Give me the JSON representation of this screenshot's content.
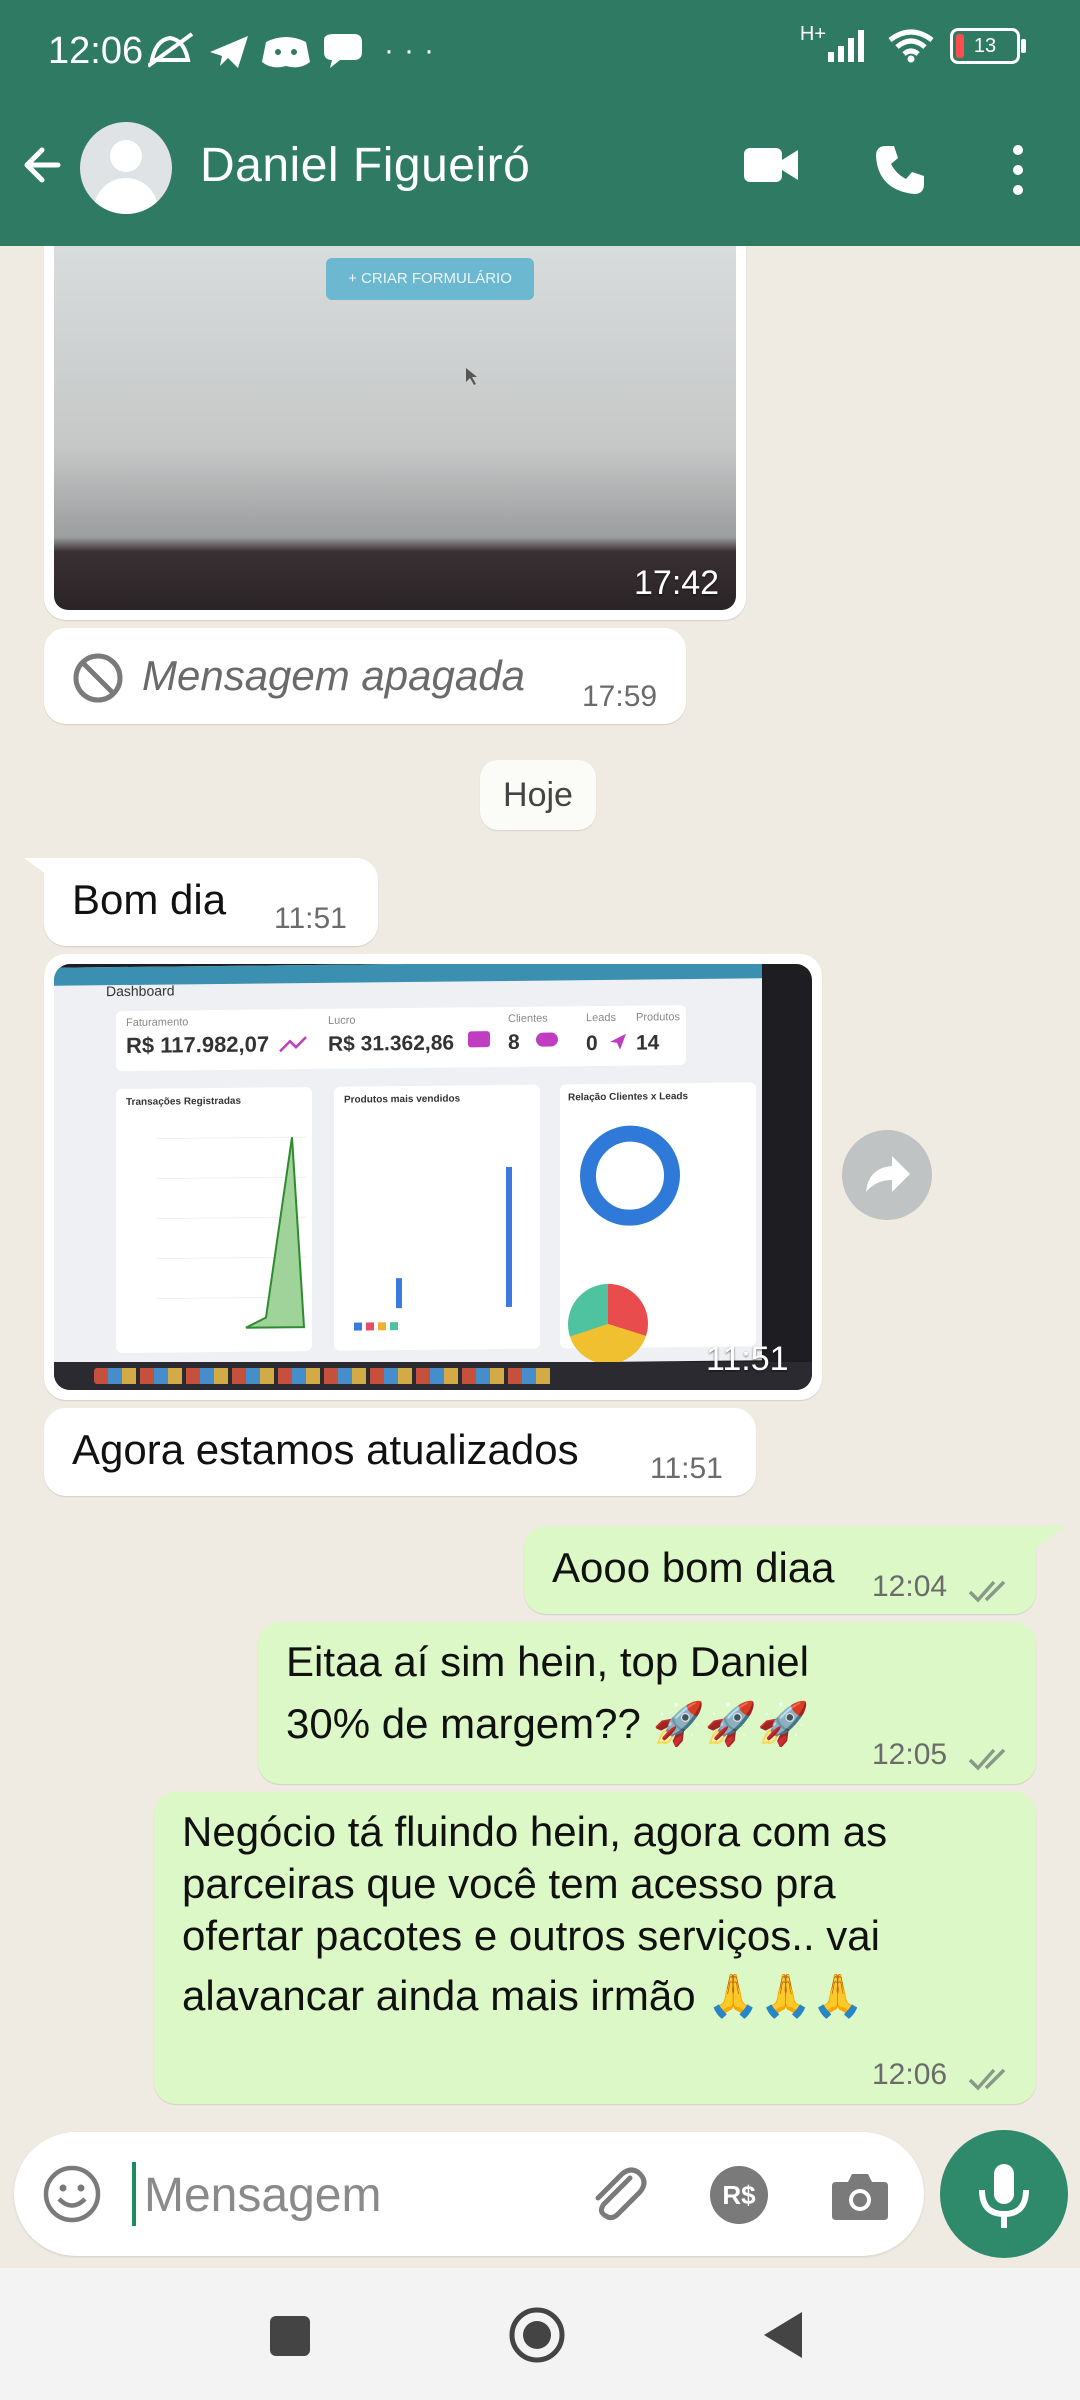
{
  "status_bar": {
    "time": "12:06",
    "more": "···",
    "network": "H+",
    "battery_level": "13"
  },
  "header": {
    "contact_name": "Daniel Figueiró",
    "back_icon": "back-arrow-icon",
    "video_icon": "video-call-icon",
    "call_icon": "phone-icon",
    "menu_icon": "more-vertical-icon",
    "bg_color": "#2f7a62"
  },
  "messages": {
    "m1_time": "17:42",
    "m1_button_label": "+ CRIAR FORMULÁRIO",
    "m2_text": "Mensagem apagada",
    "m2_time": "17:59",
    "date_chip": "Hoje",
    "m3_text": "Bom dia",
    "m3_time": "11:51",
    "m4_time": "11:51",
    "m5_text": "Agora estamos atualizados",
    "m5_time": "11:51",
    "m6_text": "Aooo bom diaa",
    "m6_time": "12:04",
    "m7_line1": "Eitaa aí sim hein, top Daniel",
    "m7_line2": "30% de margem?? 🚀🚀🚀",
    "m7_time": "12:05",
    "m8_line1": "Negócio tá fluindo hein, agora com as",
    "m8_line2": "parceiras que você tem acesso pra",
    "m8_line3": "ofertar pacotes e outros serviços.. vai",
    "m8_line4": "alavancar ainda mais irmão 🙏🙏🙏",
    "m8_time": "12:06"
  },
  "dashboard_photo": {
    "title": "Dashboard",
    "kpi1_label": "Faturamento",
    "kpi1_value": "R$ 117.982,07",
    "kpi2_label": "Lucro",
    "kpi2_value": "R$ 31.362,86",
    "kpi3_label": "Clientes",
    "kpi3_value": "8",
    "kpi4_label": "Leads",
    "kpi4_value": "0",
    "kpi5_label": "Produtos",
    "kpi5_value": "14",
    "panel1_title": "Transações Registradas",
    "panel2_title": "Produtos mais vendidos",
    "panel3_title": "Relação Clientes x Leads"
  },
  "composer": {
    "placeholder": "Mensagem",
    "emoji_icon": "emoji-icon",
    "attach_icon": "paperclip-icon",
    "payment_icon": "payment-icon",
    "camera_icon": "camera-icon",
    "mic_icon": "microphone-icon"
  },
  "navbar": {
    "square_icon": "recent-apps-icon",
    "home_icon": "home-icon",
    "back_icon": "nav-back-icon"
  }
}
